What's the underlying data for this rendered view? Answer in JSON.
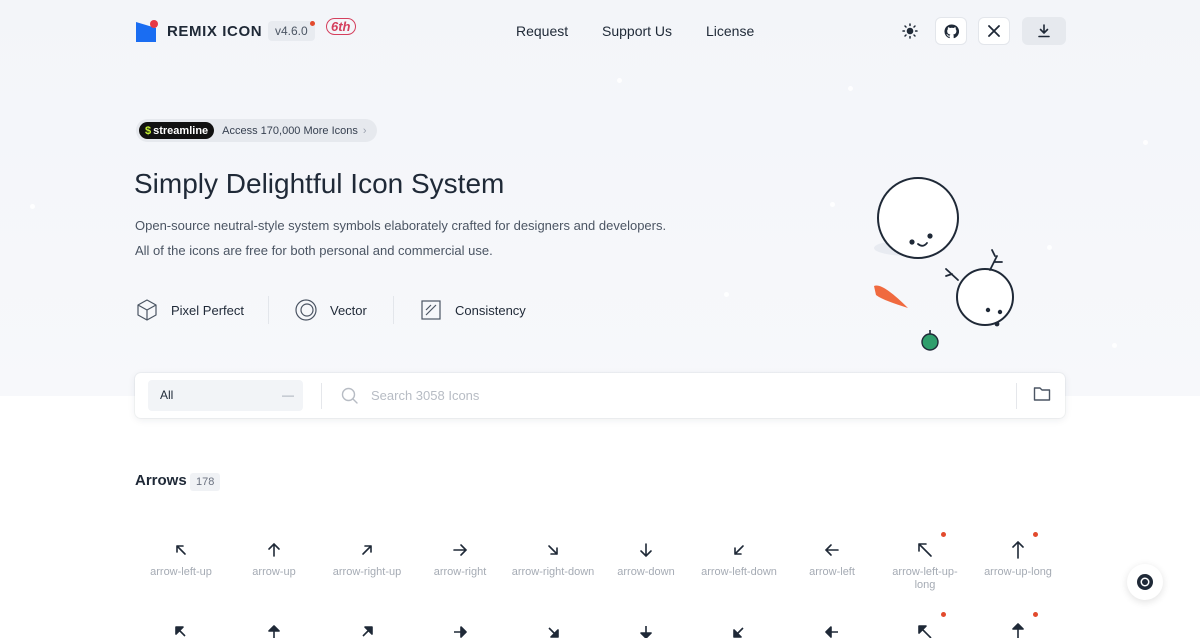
{
  "header": {
    "logo_text": "REMIX ICON",
    "version": "v4.6.0",
    "anniversary": "6th",
    "nav": [
      "Request",
      "Support Us",
      "License"
    ]
  },
  "promo": {
    "brand": "streamline",
    "text": "Access 170,000 More Icons"
  },
  "hero": {
    "title": "Simply Delightful Icon System",
    "desc_line1": "Open-source neutral-style system symbols elaborately crafted for designers and developers.",
    "desc_line2": "All of the icons are free for both personal and commercial use."
  },
  "features": [
    "Pixel Perfect",
    "Vector",
    "Consistency"
  ],
  "search": {
    "category": "All",
    "placeholder": "Search 3058 Icons"
  },
  "section": {
    "title": "Arrows",
    "count": "178"
  },
  "icons_row1": [
    "arrow-left-up",
    "arrow-up",
    "arrow-right-up",
    "arrow-right",
    "arrow-right-down",
    "arrow-down",
    "arrow-left-down",
    "arrow-left",
    "arrow-left-up-long",
    "arrow-up-long"
  ],
  "colors": {
    "brand_blue": "#1a6df2",
    "brand_red": "#e63946",
    "new_badge": "#e24a2d"
  }
}
